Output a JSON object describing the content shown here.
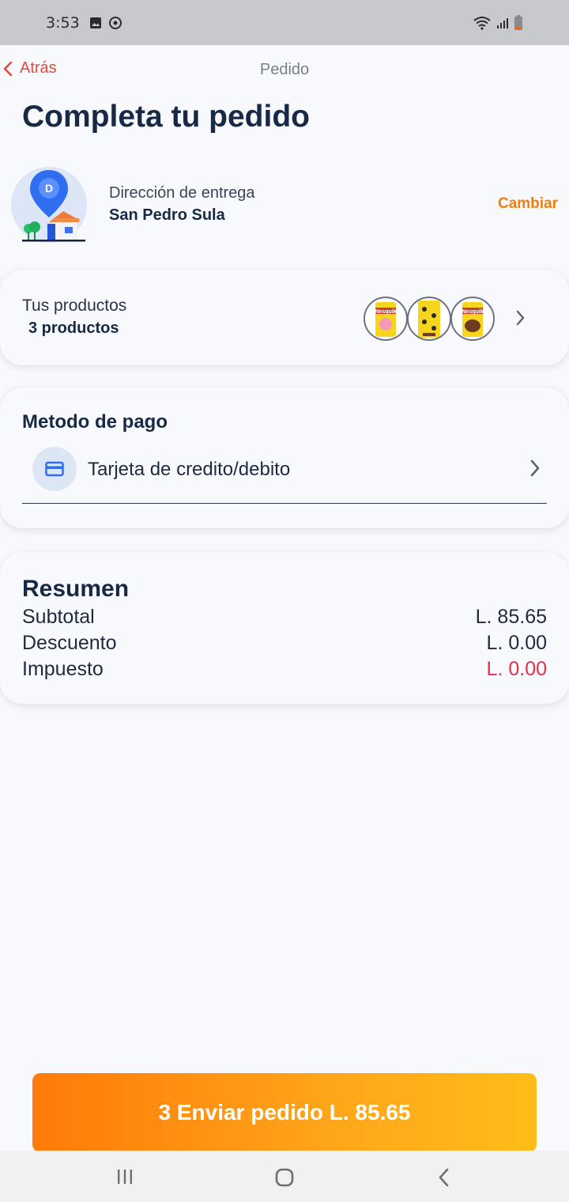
{
  "status_bar": {
    "time": "3:53"
  },
  "header": {
    "back_label": "Atrás",
    "title": "Pedido"
  },
  "page_title": "Completa tu pedido",
  "address": {
    "marker_letter": "D",
    "label": "Dirección de entrega",
    "value": "San Pedro Sula",
    "change_label": "Cambiar"
  },
  "products": {
    "label": "Tus productos",
    "count_label": "3 productos",
    "thumbnails": [
      "Nesquik",
      "Nesquik",
      "Nesquik"
    ]
  },
  "payment": {
    "title": "Metodo de pago",
    "method_label": "Tarjeta de credito/debito"
  },
  "summary": {
    "title": "Resumen",
    "rows": [
      {
        "label": "Subtotal",
        "value": "L. 85.65",
        "color": "#1f2a40"
      },
      {
        "label": "Descuento",
        "value": "L. 0.00",
        "color": "#1f2a40"
      },
      {
        "label": "Impuesto",
        "value": "L. 0.00",
        "color": "#e0304a"
      }
    ]
  },
  "submit_button": {
    "label": "3 Enviar pedido L. 85.65"
  },
  "colors": {
    "accent_orange": "#f07d0c",
    "back_red": "#e04a3f",
    "navy": "#182946",
    "tax_red": "#e0304a"
  }
}
